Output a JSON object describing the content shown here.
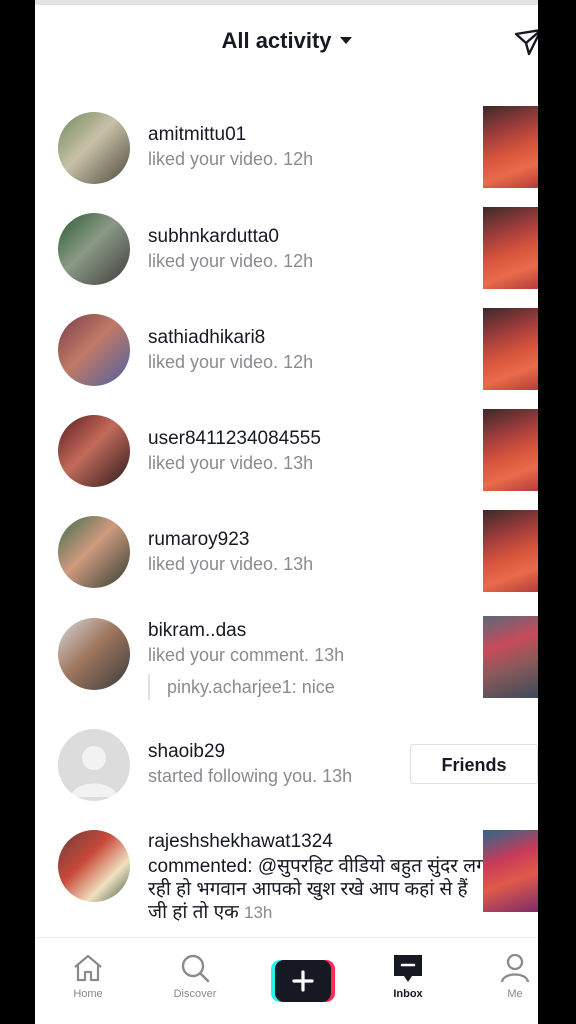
{
  "header": {
    "title": "All activity"
  },
  "notifications": [
    {
      "username": "amitmittu01",
      "action": "liked your video.",
      "time": "12h",
      "thumb_theme": "red"
    },
    {
      "username": "subhnkardutta0",
      "action": "liked your video.",
      "time": "12h",
      "thumb_theme": "red"
    },
    {
      "username": "sathiadhikari8",
      "action": "liked your video.",
      "time": "12h",
      "thumb_theme": "red"
    },
    {
      "username": "user8411234084555",
      "action": "liked your video.",
      "time": "13h",
      "thumb_theme": "red"
    },
    {
      "username": "rumaroy923",
      "action": "liked your video.",
      "time": "13h",
      "thumb_theme": "red"
    },
    {
      "username": "bikram..das",
      "action": "liked your comment.",
      "time": "13h",
      "reply": "pinky.acharjee1: nice",
      "thumb_theme": "street"
    },
    {
      "username": "shaoib29",
      "action": "started following you.",
      "time": "13h",
      "button": "Friends"
    },
    {
      "username": "rajeshshekhawat1324",
      "comment": "commented: @सुपरहिट वीडियो बहुत सुंदर लग रही हो भगवान आपको खुश रखे आप कहां से हैं जी हां तो एक",
      "time": "13h",
      "thumb_theme": "bride"
    }
  ],
  "tabs": [
    {
      "label": "Home",
      "icon": "home-icon"
    },
    {
      "label": "Discover",
      "icon": "search-icon"
    },
    {
      "label": "",
      "icon": "plus-icon"
    },
    {
      "label": "Inbox",
      "icon": "inbox-icon",
      "active": true
    },
    {
      "label": "Me",
      "icon": "person-icon"
    }
  ]
}
